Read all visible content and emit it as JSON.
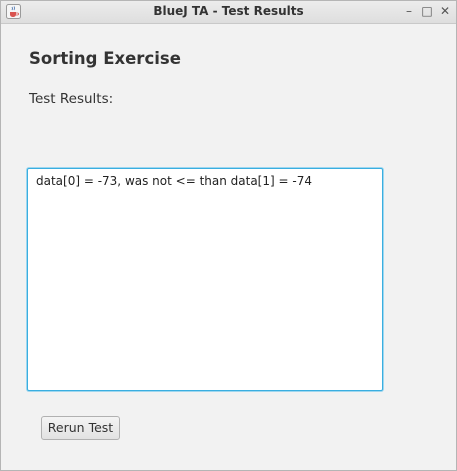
{
  "window": {
    "title": "BlueJ TA - Test Results",
    "icon": "java-cup-icon",
    "controls": {
      "minimize": "–",
      "maximize": "□",
      "close": "✕"
    }
  },
  "main": {
    "heading": "Sorting Exercise",
    "results_label": "Test Results:",
    "results_text": "data[0] = -73, was not <= than data[1] = -74",
    "rerun_label": "Rerun Test"
  },
  "colors": {
    "focus_border": "#3aaee0",
    "background": "#f2f2f2"
  }
}
